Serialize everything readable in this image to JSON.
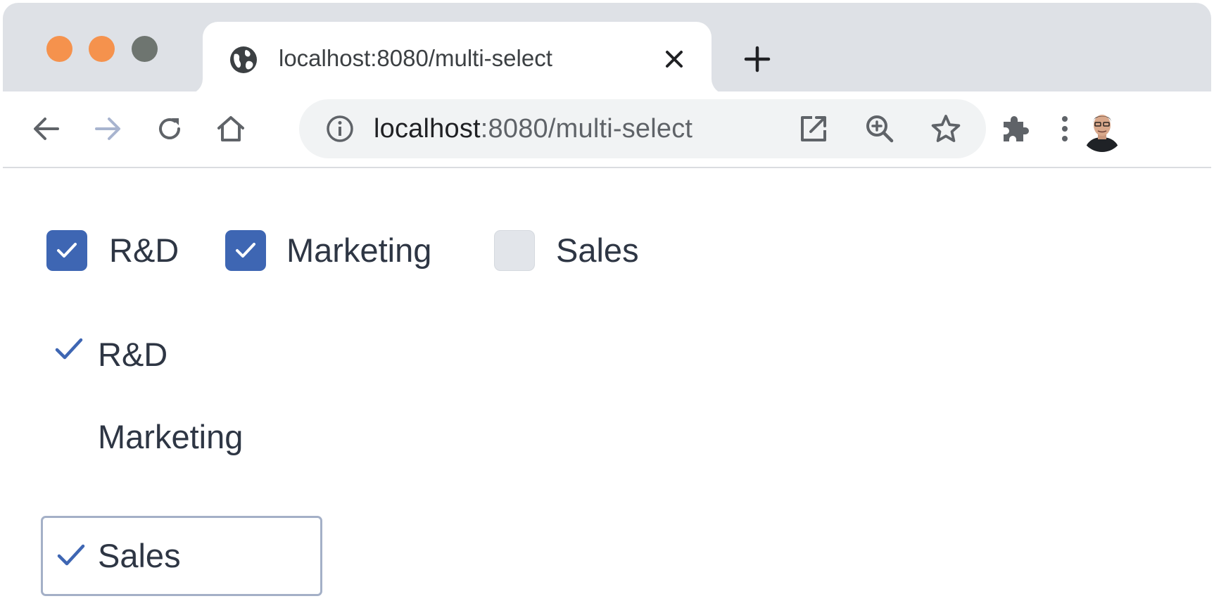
{
  "browser": {
    "tab": {
      "title": "localhost:8080/multi-select",
      "favicon": "globe-icon"
    },
    "new_tab_label": "+",
    "toolbar": {
      "back": "arrow-left-icon",
      "forward": "arrow-right-icon",
      "reload": "reload-icon",
      "home": "home-icon"
    },
    "omnibox": {
      "host": "localhost",
      "path": ":8080/multi-select",
      "icons": [
        "info-icon",
        "open-external-icon",
        "zoom-icon",
        "star-icon"
      ]
    },
    "extensions_icon": "puzzle-icon",
    "menu_icon": "kebab-menu-icon"
  },
  "checkbox_group": {
    "items": [
      {
        "label": "R&D",
        "checked": true
      },
      {
        "label": "Marketing",
        "checked": true
      },
      {
        "label": "Sales",
        "checked": false
      }
    ]
  },
  "listbox": {
    "items": [
      {
        "label": "R&D",
        "selected": true,
        "focused": false
      },
      {
        "label": "Marketing",
        "selected": false,
        "focused": false
      },
      {
        "label": "Sales",
        "selected": true,
        "focused": true
      }
    ]
  },
  "colors": {
    "accent": "#3e66b3",
    "tabstrip": "#dee1e6",
    "traffic_red": "#f5924d",
    "traffic_yellow": "#f5924d",
    "traffic_green": "#6e7570",
    "text": "#2e3644",
    "focus_ring": "#a4b0c7"
  }
}
